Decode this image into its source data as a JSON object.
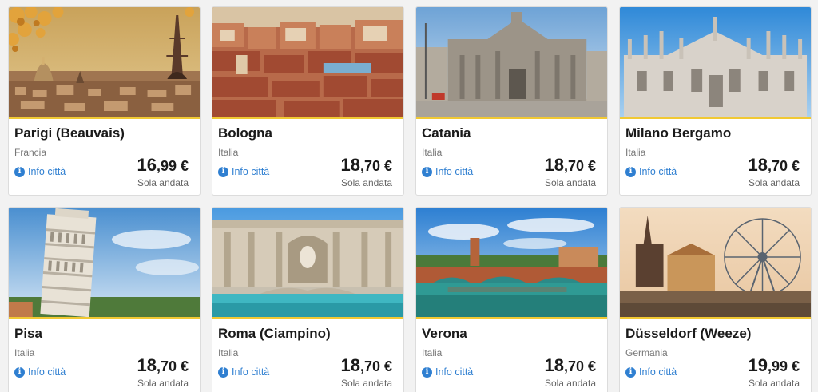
{
  "destinations": [
    {
      "city": "Parigi (Beauvais)",
      "country": "Francia",
      "price_int": "16",
      "price_dec": ",99",
      "currency": " €",
      "info_label": "Info città",
      "fare_type": "Sola andata",
      "image": "eiffel-tower-photo"
    },
    {
      "city": "Bologna",
      "country": "Italia",
      "price_int": "18",
      "price_dec": ",70",
      "currency": " €",
      "info_label": "Info città",
      "fare_type": "Sola andata",
      "image": "bologna-rooftops-photo"
    },
    {
      "city": "Catania",
      "country": "Italia",
      "price_int": "18",
      "price_dec": ",70",
      "currency": " €",
      "info_label": "Info città",
      "fare_type": "Sola andata",
      "image": "catania-cathedral-photo"
    },
    {
      "city": "Milano Bergamo",
      "country": "Italia",
      "price_int": "18",
      "price_dec": ",70",
      "currency": " €",
      "info_label": "Info città",
      "fare_type": "Sola andata",
      "image": "milan-duomo-photo"
    },
    {
      "city": "Pisa",
      "country": "Italia",
      "price_int": "18",
      "price_dec": ",70",
      "currency": " €",
      "info_label": "Info città",
      "fare_type": "Sola andata",
      "image": "leaning-tower-photo"
    },
    {
      "city": "Roma (Ciampino)",
      "country": "Italia",
      "price_int": "18",
      "price_dec": ",70",
      "currency": " €",
      "info_label": "Info città",
      "fare_type": "Sola andata",
      "image": "trevi-fountain-photo"
    },
    {
      "city": "Verona",
      "country": "Italia",
      "price_int": "18",
      "price_dec": ",70",
      "currency": " €",
      "info_label": "Info città",
      "fare_type": "Sola andata",
      "image": "verona-bridge-photo"
    },
    {
      "city": "Düsseldorf (Weeze)",
      "country": "Germania",
      "price_int": "19",
      "price_dec": ",99",
      "currency": " €",
      "info_label": "Info città",
      "fare_type": "Sola andata",
      "image": "ferris-wheel-photo"
    }
  ],
  "colors": {
    "accent_yellow": "#f1c933",
    "link_blue": "#2f7fd1",
    "page_bg": "#f2f2f2"
  },
  "icons": {
    "info": "info-circle-icon"
  }
}
